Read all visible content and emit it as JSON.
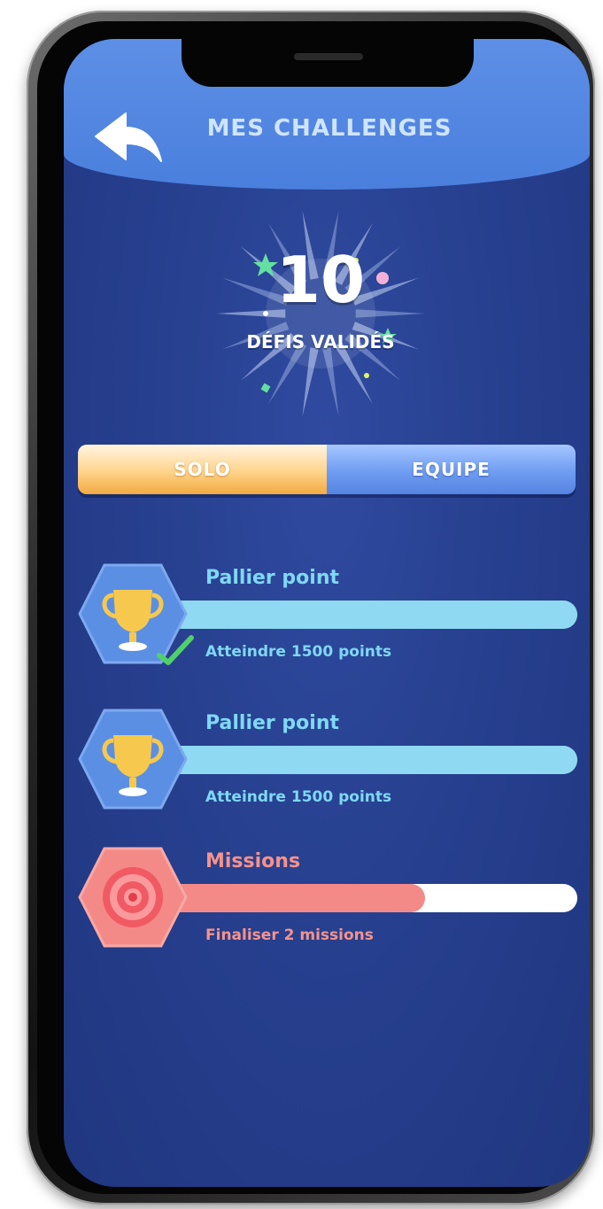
{
  "header": {
    "title": "MES CHALLENGES",
    "back_icon": "back-arrow-icon"
  },
  "badge": {
    "count": "10",
    "label": "DÉFIS VALIDÉS"
  },
  "tabs": [
    {
      "label": "SOLO",
      "selected": true
    },
    {
      "label": "EQUIPE",
      "selected": false
    }
  ],
  "challenges": [
    {
      "title": "Pallier point",
      "subtitle": "Atteindre 1500 points",
      "icon": "trophy-icon",
      "progress": 1.0,
      "completed": true
    },
    {
      "title": "Pallier point",
      "subtitle": "Atteindre 1500 points",
      "icon": "trophy-icon",
      "progress": 1.0,
      "completed": false
    },
    {
      "title": "Missions",
      "subtitle": "Finaliser 2 missions",
      "icon": "target-icon",
      "progress": 0.63,
      "completed": false
    }
  ],
  "colors": {
    "background": "#27408f",
    "header": "#4a7fdd",
    "trophy_accent": "#8fd9f3",
    "mission_accent": "#f48a88",
    "solo_tab": "#ffd38b",
    "equipe_tab": "#6f9df2"
  }
}
